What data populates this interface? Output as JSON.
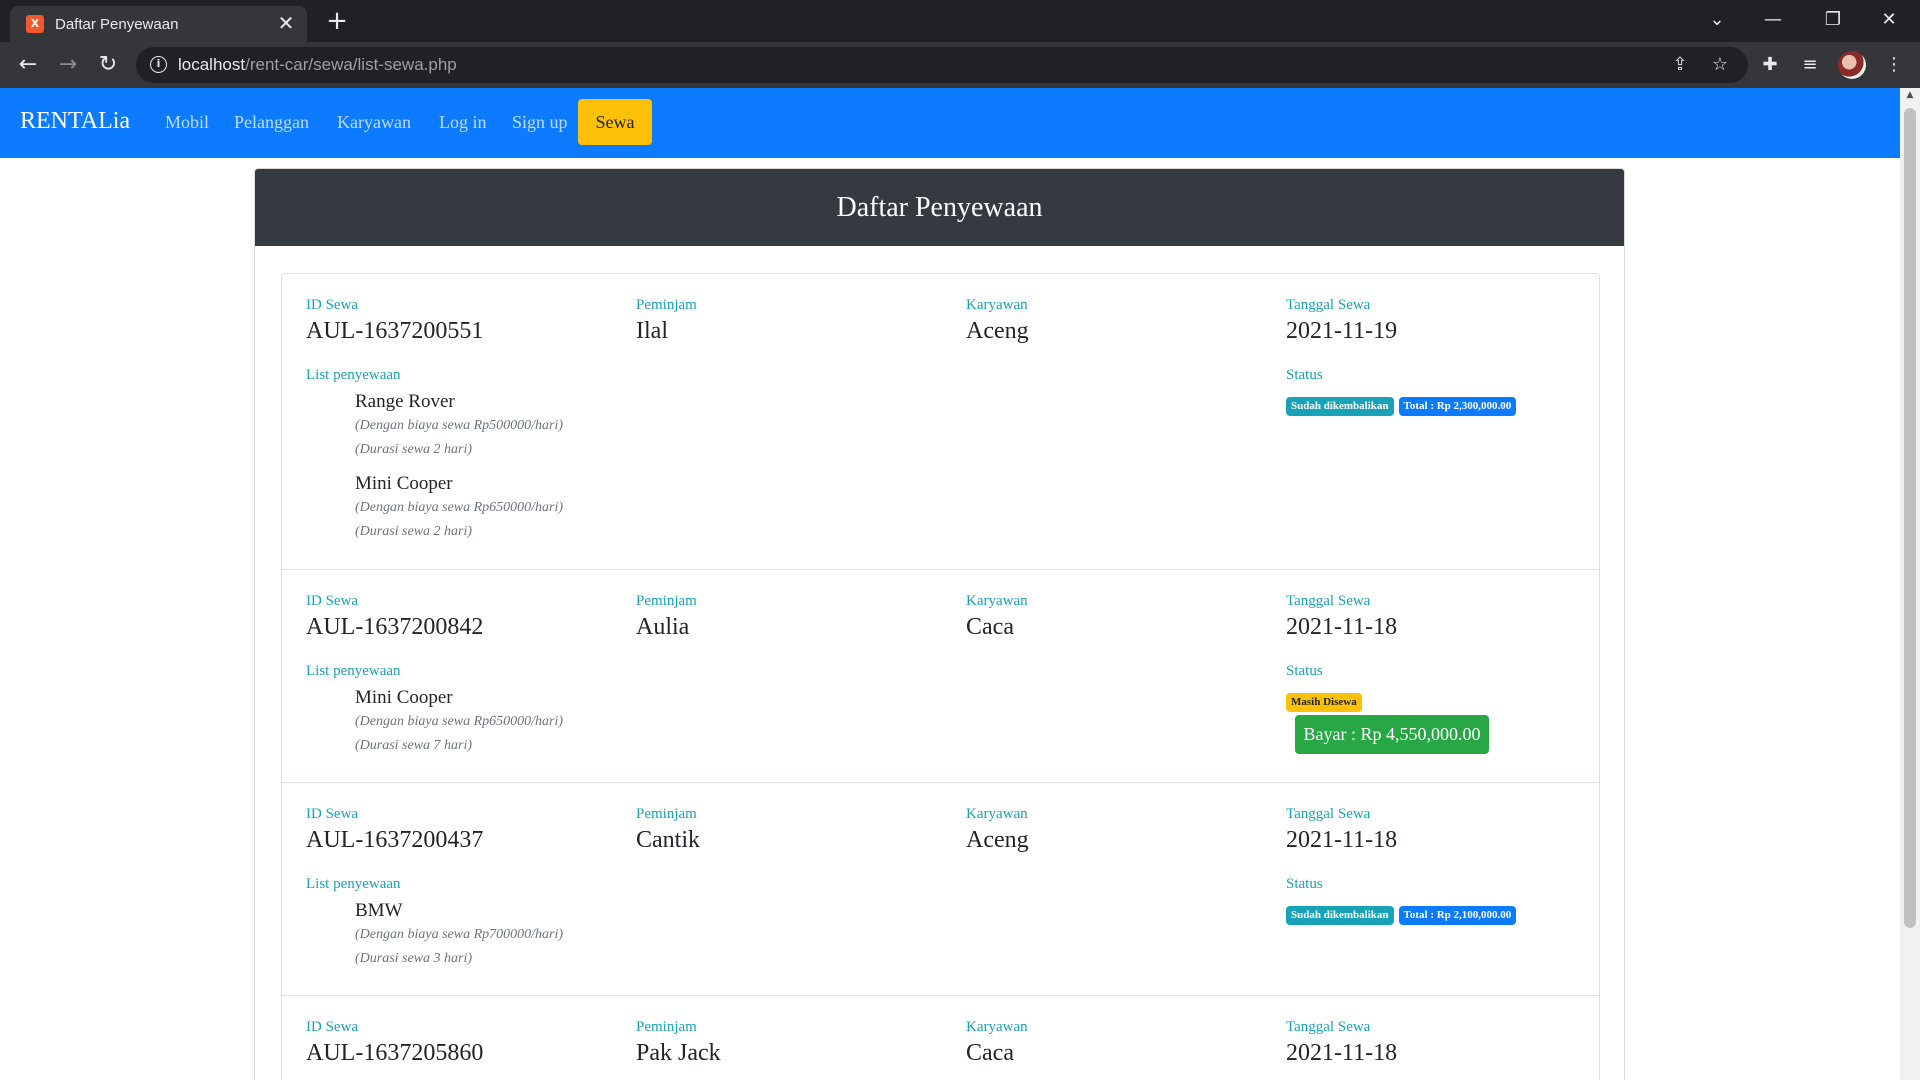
{
  "browser": {
    "tab_title": "Daftar Penyewaan",
    "favicon_text": "X",
    "url_host": "localhost",
    "url_path": "/rent-car/sewa/list-sewa.php",
    "icons": {
      "close": "✕",
      "new_tab": "+",
      "tab_list": "⌄",
      "minimize": "—",
      "restore": "❐",
      "window_close": "✕",
      "back": "←",
      "forward": "→",
      "reload": "↻",
      "info": "i",
      "share": "⇪",
      "star": "☆",
      "extensions": "✚",
      "media": "≡",
      "menu": "⋮"
    }
  },
  "navbar": {
    "brand": "RENTALia",
    "links": [
      "Mobil",
      "Pelanggan",
      "Karyawan",
      "Log in",
      "Sign up"
    ],
    "active": "Sewa",
    "colors": {
      "bg": "#0d7bff",
      "active_bg": "#ffc107"
    }
  },
  "header": {
    "title": "Daftar Penyewaan"
  },
  "labels": {
    "id": "ID Sewa",
    "borrower": "Peminjam",
    "employee": "Karyawan",
    "date": "Tanggal Sewa",
    "list": "List penyewaan",
    "status": "Status"
  },
  "rentals": [
    {
      "id": "AUL-1637200551",
      "borrower": "Ilal",
      "employee": "Aceng",
      "date": "2021-11-19",
      "cars": [
        {
          "name": "Range Rover",
          "rate": "(Dengan biaya sewa Rp500000/hari)",
          "duration": "(Durasi sewa 2 hari)"
        },
        {
          "name": "Mini Cooper",
          "rate": "(Dengan biaya sewa Rp650000/hari)",
          "duration": "(Durasi sewa 2 hari)"
        }
      ],
      "status": "Sudah dikembalikan",
      "total": "Total : Rp 2,300,000.00"
    },
    {
      "id": "AUL-1637200842",
      "borrower": "Aulia",
      "employee": "Caca",
      "date": "2021-11-18",
      "cars": [
        {
          "name": "Mini Cooper",
          "rate": "(Dengan biaya sewa Rp650000/hari)",
          "duration": "(Durasi sewa 7 hari)"
        }
      ],
      "status": "Masih Disewa",
      "pay_button": "Bayar : Rp 4,550,000.00"
    },
    {
      "id": "AUL-1637200437",
      "borrower": "Cantik",
      "employee": "Aceng",
      "date": "2021-11-18",
      "cars": [
        {
          "name": "BMW",
          "rate": "(Dengan biaya sewa Rp700000/hari)",
          "duration": "(Durasi sewa 3 hari)"
        }
      ],
      "status": "Sudah dikembalikan",
      "total": "Total : Rp 2,100,000.00"
    },
    {
      "id": "AUL-1637205860",
      "borrower": "Pak Jack",
      "employee": "Caca",
      "date": "2021-11-18",
      "cars": []
    }
  ]
}
